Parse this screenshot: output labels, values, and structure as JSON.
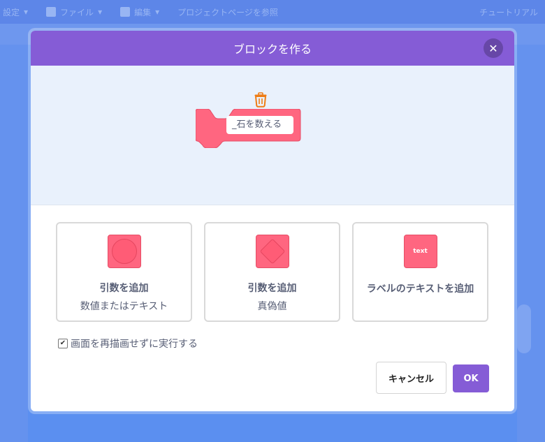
{
  "background": {
    "menu": [
      "設定",
      "ファイル",
      "編集",
      "プロジェクトページを参照"
    ],
    "tutorial": "チュートリアル"
  },
  "modal": {
    "title": "ブロックを作る",
    "close_icon": "close-icon",
    "block_label": "_石を数える",
    "options": [
      {
        "title": "引数を追加",
        "subtitle": "数値またはテキスト",
        "icon": "round-input-icon"
      },
      {
        "title": "引数を追加",
        "subtitle": "真偽値",
        "icon": "boolean-input-icon"
      },
      {
        "title": "ラベルのテキストを追加",
        "icon_text": "text",
        "icon": "label-text-icon"
      }
    ],
    "run_without_refresh": {
      "label": "画面を再描画せずに実行する",
      "checked": true
    },
    "cancel_label": "キャンセル",
    "ok_label": "OK"
  },
  "colors": {
    "header": "#855cd6",
    "block": "#ff6680",
    "preview_bg": "#e9f1fc"
  }
}
